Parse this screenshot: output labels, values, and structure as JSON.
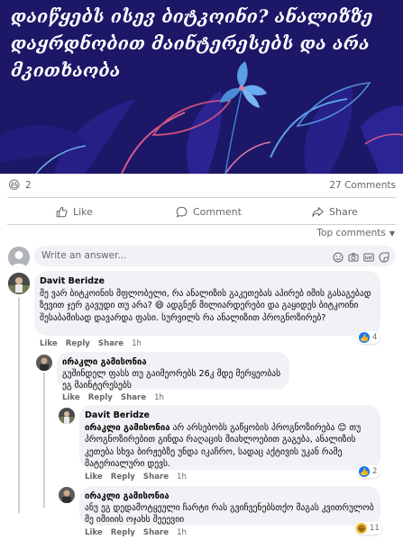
{
  "hero": {
    "title": "დაიწყებს ისევ ბიტკოინი? ანალიზზე დაყრდნობით მაინტერესებს და არა მკითხაობა"
  },
  "summary": {
    "reaction_icon": "haha-emoji",
    "reaction_count": "2",
    "comments_count": "27 Comments"
  },
  "actions": {
    "like": "Like",
    "comment": "Comment",
    "share": "Share"
  },
  "sort": {
    "label": "Top comments"
  },
  "composer": {
    "placeholder": "Write an answer..."
  },
  "comments": [
    {
      "author": "Davit Beridze",
      "text": "მე ვარ ბიტკოინის მფლობელი, რა ანალიზის გაკეთებას აპირებ იმის გასაგებად ზევით ჯერ გავუდი თუ არა? 😄 ადგნენ მილიარდერები და გაყიდეს ბიტკოინი შესაბამისად დავარდა ფასი. სურვილს რა ანალიზით პროგნოზირებ?",
      "like": "Like",
      "reply": "Reply",
      "share": "Share",
      "time": "1h",
      "reaction_count": "4"
    },
    {
      "author": "ირაკლი გამისონია",
      "text": "გუშინდელ ფასს თუ გაიმეორებს 26კ მდე მერყეობას ეგ მაინტერესებს",
      "like": "Like",
      "reply": "Reply",
      "share": "Share",
      "time": "1h"
    },
    {
      "author": "Davit Beridze",
      "mention": "ირაკლი გამისონია",
      "text": " არ არსებობს გაწყობის პროგნოზირება 😊 თუ პროგნოზირებით გინდა რაღაცის მიახლოებით გაგება, ანალიზის კეთება სხვა ბირჟებზე უნდა იკაჩრო, სადაც აქტივის უკან რამე მატერიალური დევს.",
      "like": "Like",
      "reply": "Reply",
      "share": "Share",
      "time": "1h",
      "reaction_count": "2"
    },
    {
      "author": "ირაკლი გამისონია",
      "text": "ანუ ეგ დედამოტყეული ჩარტი რას გვიჩვენებსთქო მაგას კვითრულობ მე იმიიის ოჯახს შეეევიი",
      "like": "Like",
      "reply": "Reply",
      "share": "Share",
      "time": "1h",
      "reaction_count": "11"
    }
  ],
  "colors": {
    "hero_bg": "#1d1768",
    "link_blue": "#1877f2",
    "muted": "#65676b",
    "bubble": "#f0f2f5"
  }
}
